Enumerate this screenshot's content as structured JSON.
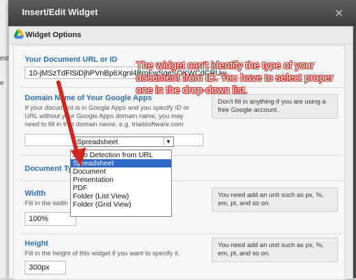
{
  "background": {
    "fragments": [
      "estone",
      "e"
    ]
  },
  "dialog": {
    "title": "Insert/Edit Widget",
    "close_symbol": "×"
  },
  "panel": {
    "title": "Widget Options"
  },
  "fields": {
    "doc_url": {
      "label": "Your Document URL or ID",
      "value": "10-jMSzTdFlSiDjhPVnBp6Xgnl4BmFwSqeSOKWCdCRUw"
    },
    "domain": {
      "label": "Domain Name of Your Google Apps",
      "desc_line1": "If your document is in Google Apps and you specify ID or",
      "desc_line2": "URL without your Google Apps domain name, you may",
      "desc_line3": "need to fill in that domain name, e.g. triadsoftware.com",
      "value": "",
      "note": "Don't fill in anything if you are using a free Google account."
    },
    "doc_type": {
      "label": "Document Type",
      "selected": "Spreadsheet",
      "options": [
        "Auto Detection from URL",
        "Spreadsheet",
        "Document",
        "Presentation",
        "PDF",
        "Folder (List View)",
        "Folder (Grid View)"
      ],
      "highlighted_index": 1
    },
    "width": {
      "label": "Width",
      "desc": "Fill in the width of the",
      "value": "100%",
      "note": "You need add an unit such as px, %, em, pt, and so on."
    },
    "height": {
      "label": "Height",
      "desc": "Fill in the height of this widget if you want to specify it.",
      "value": "300px",
      "note": "You need add an unit such as px, %, em, pt, and so on."
    }
  },
  "annotation": {
    "text": "The widget can't identify the type of your document from ID. You have to select proper one in the drop-down list.",
    "color": "#d0281f"
  },
  "colors": {
    "label_blue": "#2c6da8",
    "selection_blue": "#2f67c8"
  }
}
